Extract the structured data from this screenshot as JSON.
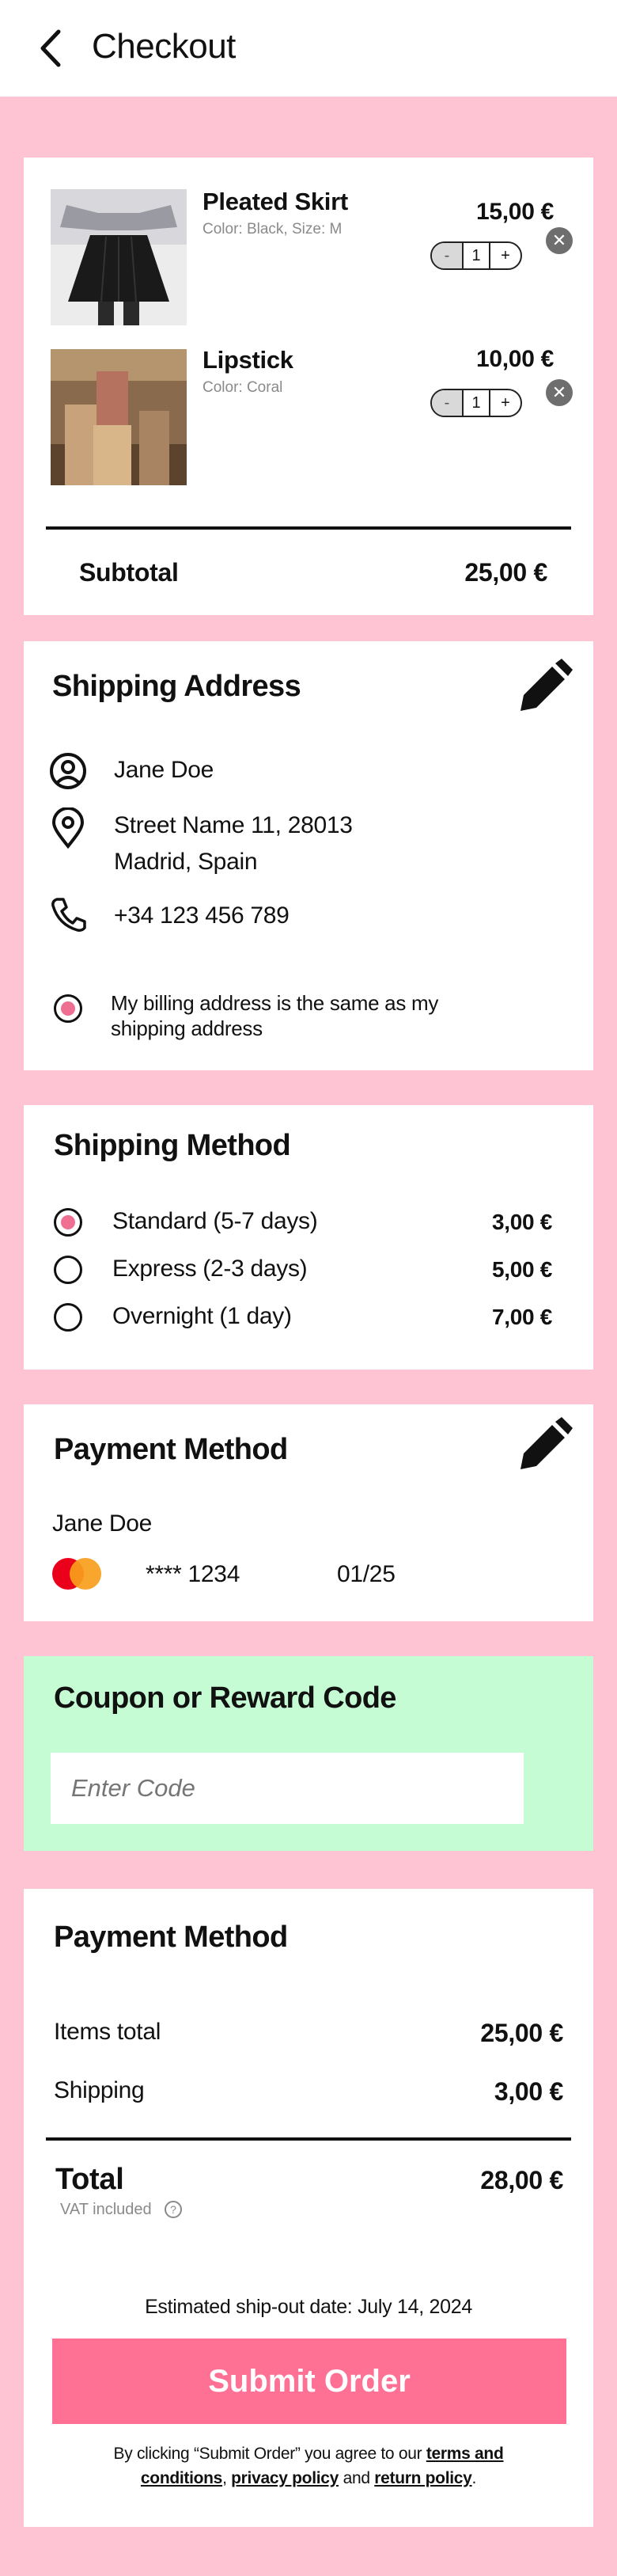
{
  "header": {
    "title": "Checkout"
  },
  "cart": {
    "items": [
      {
        "name": "Pleated Skirt",
        "details": "Color: Black, Size: M",
        "price": "15,00 €",
        "qty": "1"
      },
      {
        "name": "Lipstick",
        "details": "Color: Coral",
        "price": "10,00 €",
        "qty": "1"
      }
    ],
    "stepper": {
      "minus": "-",
      "plus": "+"
    },
    "remove_glyph": "✕",
    "subtotal_label": "Subtotal",
    "subtotal_value": "25,00 €"
  },
  "shipping_address": {
    "title": "Shipping Address",
    "name": "Jane Doe",
    "street": "Street Name 11, 28013",
    "city": "Madrid, Spain",
    "phone": "+34 123 456 789",
    "billing_same_line1": "My billing address is the same as my",
    "billing_same_line2": "shipping address"
  },
  "shipping_method": {
    "title": "Shipping Method",
    "options": [
      {
        "label": "Standard (5-7 days)",
        "price": "3,00 €",
        "selected": true
      },
      {
        "label": "Express (2-3 days)",
        "price": "5,00 €",
        "selected": false
      },
      {
        "label": "Overnight (1 day)",
        "price": "7,00 €",
        "selected": false
      }
    ]
  },
  "payment_method": {
    "title": "Payment Method",
    "cardholder": "Jane Doe",
    "card_number": "**** 1234",
    "expiry": "01/25",
    "card_brand_colors": [
      "#eb001b",
      "#f79e1b"
    ]
  },
  "coupon": {
    "title": "Coupon or Reward Code",
    "placeholder": "Enter Code",
    "background": "#c6fcd4"
  },
  "summary": {
    "title": "Payment Method",
    "items_total_label": "Items total",
    "items_total_value": "25,00 €",
    "shipping_label": "Shipping",
    "shipping_value": "3,00 €",
    "total_label": "Total",
    "total_value": "28,00 €",
    "vat_note": "VAT included",
    "vat_help_glyph": "?",
    "ship_date": "Estimated ship-out date: July 14, 2024",
    "submit_label": "Submit Order",
    "submit_color": "#ff7095",
    "legal_prefix": "By clicking “Submit Order” you agree to our ",
    "legal_terms_a": "terms and",
    "legal_terms_b": "conditions",
    "legal_sep": ", ",
    "legal_privacy": "privacy policy",
    "legal_and": " and ",
    "legal_return": "return policy",
    "legal_end": "."
  },
  "colors": {
    "page_bg": "#ffc4d3",
    "accent": "#ef6f93"
  }
}
